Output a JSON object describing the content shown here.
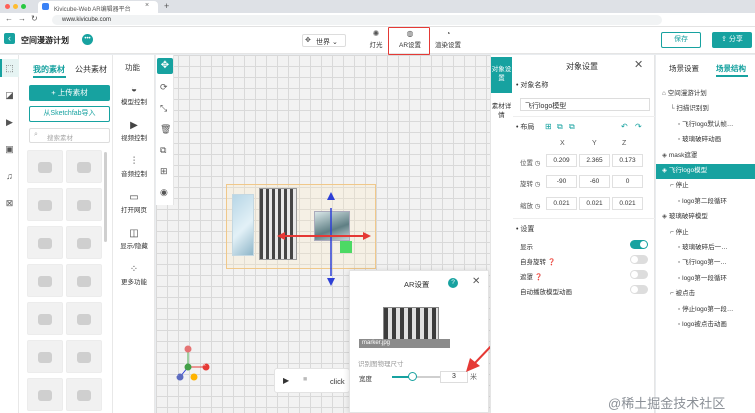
{
  "browser": {
    "tab_title": "Kivicube-Web AR编辑器平台",
    "url": "www.kivicube.com",
    "glyph_back": "←",
    "glyph_forward": "→",
    "glyph_reload": "↻",
    "glyph_close": "×",
    "glyph_newtab": "+"
  },
  "header": {
    "back_icon": "‹",
    "title": "空间漫游计划",
    "chat_icon": "•••",
    "world_select": "世界 ⌄",
    "world_icon": "✥",
    "toolbar": [
      {
        "label": "灯光",
        "icon": "✺"
      },
      {
        "label": "AR设置",
        "icon": "◍"
      },
      {
        "label": "渲染设置",
        "icon": "◔"
      }
    ],
    "save_label": "保存",
    "share_label": "分享",
    "share_icon": "⇪"
  },
  "rail_icons": [
    "⬚",
    "◪",
    "▶",
    "▣",
    "♫",
    "⊠"
  ],
  "materials": {
    "tabs": [
      "我的素材",
      "公共素材"
    ],
    "upload_label": "+ 上传素材",
    "sketchfab_label": "从Sketchfab导入",
    "search_placeholder": "搜索素材",
    "search_icon": "⌕"
  },
  "functions": {
    "title": "功能",
    "items": [
      {
        "label": "模型控制",
        "icon": "◒"
      },
      {
        "label": "视频控制",
        "icon": "▶"
      },
      {
        "label": "音频控制",
        "icon": "⫶"
      },
      {
        "label": "打开网页",
        "icon": "▭"
      },
      {
        "label": "显示/隐藏",
        "icon": "◫"
      },
      {
        "label": "更多功能",
        "icon": "⁘"
      }
    ]
  },
  "canvas": {
    "tools": [
      "✥",
      "⟳",
      "⤡",
      "🗑",
      "⧉",
      "⊞",
      "◉"
    ],
    "axis_labels": [
      "X",
      "Y",
      "Z",
      "-X",
      "-Y",
      "-Z"
    ],
    "play_icon": "▶",
    "stop_icon": "■",
    "click_label": "click"
  },
  "ar_popup": {
    "title": "AR设置",
    "help_icon": "?",
    "close_icon": "✕",
    "image_caption": "marker.jpg",
    "hint": "识别图物理尺寸",
    "width_label": "宽度",
    "width_value": "3",
    "width_slider": 0.4,
    "unit": "米"
  },
  "side_tabs": [
    "对象设置",
    "素材详情"
  ],
  "object_settings": {
    "title": "对象设置",
    "close_icon": "✕",
    "name_label": "• 对象名称",
    "name_value": "飞行logo模型",
    "layout_label": "• 布局",
    "layout_icons": [
      "⊞",
      "⧉",
      "⧉"
    ],
    "undo_icons": [
      "↶",
      "↷"
    ],
    "axes": [
      "X",
      "Y",
      "Z"
    ],
    "rows": [
      {
        "label": "位置 ◷",
        "values": [
          "0.209",
          "2.365",
          "0.173"
        ]
      },
      {
        "label": "旋转 ◷",
        "values": [
          "-90",
          "-60",
          "0"
        ]
      },
      {
        "label": "缩放 ◷",
        "values": [
          "0.021",
          "0.021",
          "0.021"
        ]
      }
    ],
    "settings_label": "• 设置",
    "toggles": [
      {
        "label": "显示",
        "on": true
      },
      {
        "label": "自身旋转 ❓",
        "on": false
      },
      {
        "label": "遮罩 ❓",
        "on": false
      },
      {
        "label": "自动播放模型动画",
        "on": false
      }
    ]
  },
  "scene": {
    "tabs": [
      "场景设置",
      "场景结构"
    ],
    "tree": [
      {
        "label": "空间漫游计划",
        "icon": "⌂",
        "indent": 0
      },
      {
        "label": "扫描识别到",
        "icon": "└",
        "indent": 1
      },
      {
        "label": "飞行logo默认帧…",
        "icon": "▫",
        "indent": 2
      },
      {
        "label": "玻璃破碎动画",
        "icon": "▫",
        "indent": 2
      },
      {
        "label": "mask遮罩",
        "icon": "◈",
        "indent": 0
      },
      {
        "label": "飞行logo模型",
        "icon": "◈",
        "indent": 0,
        "selected": true
      },
      {
        "label": "停止",
        "icon": "⌐",
        "indent": 1
      },
      {
        "label": "logo第二段循环",
        "icon": "▫",
        "indent": 2
      },
      {
        "label": "玻璃破碎模型",
        "icon": "◈",
        "indent": 0
      },
      {
        "label": "停止",
        "icon": "⌐",
        "indent": 1
      },
      {
        "label": "玻璃破碎后一…",
        "icon": "▫",
        "indent": 2
      },
      {
        "label": "飞行logo第一…",
        "icon": "▫",
        "indent": 2
      },
      {
        "label": "logo第一段循环",
        "icon": "▫",
        "indent": 2
      },
      {
        "label": "被点击",
        "icon": "⌐",
        "indent": 1
      },
      {
        "label": "停止logo第一段…",
        "icon": "▫",
        "indent": 2
      },
      {
        "label": "logo被点击动画",
        "icon": "▫",
        "indent": 2
      }
    ]
  },
  "watermark": "@稀土掘金技术社区",
  "colors": {
    "accent": "#17a2a0",
    "highlight": "#e53935"
  }
}
